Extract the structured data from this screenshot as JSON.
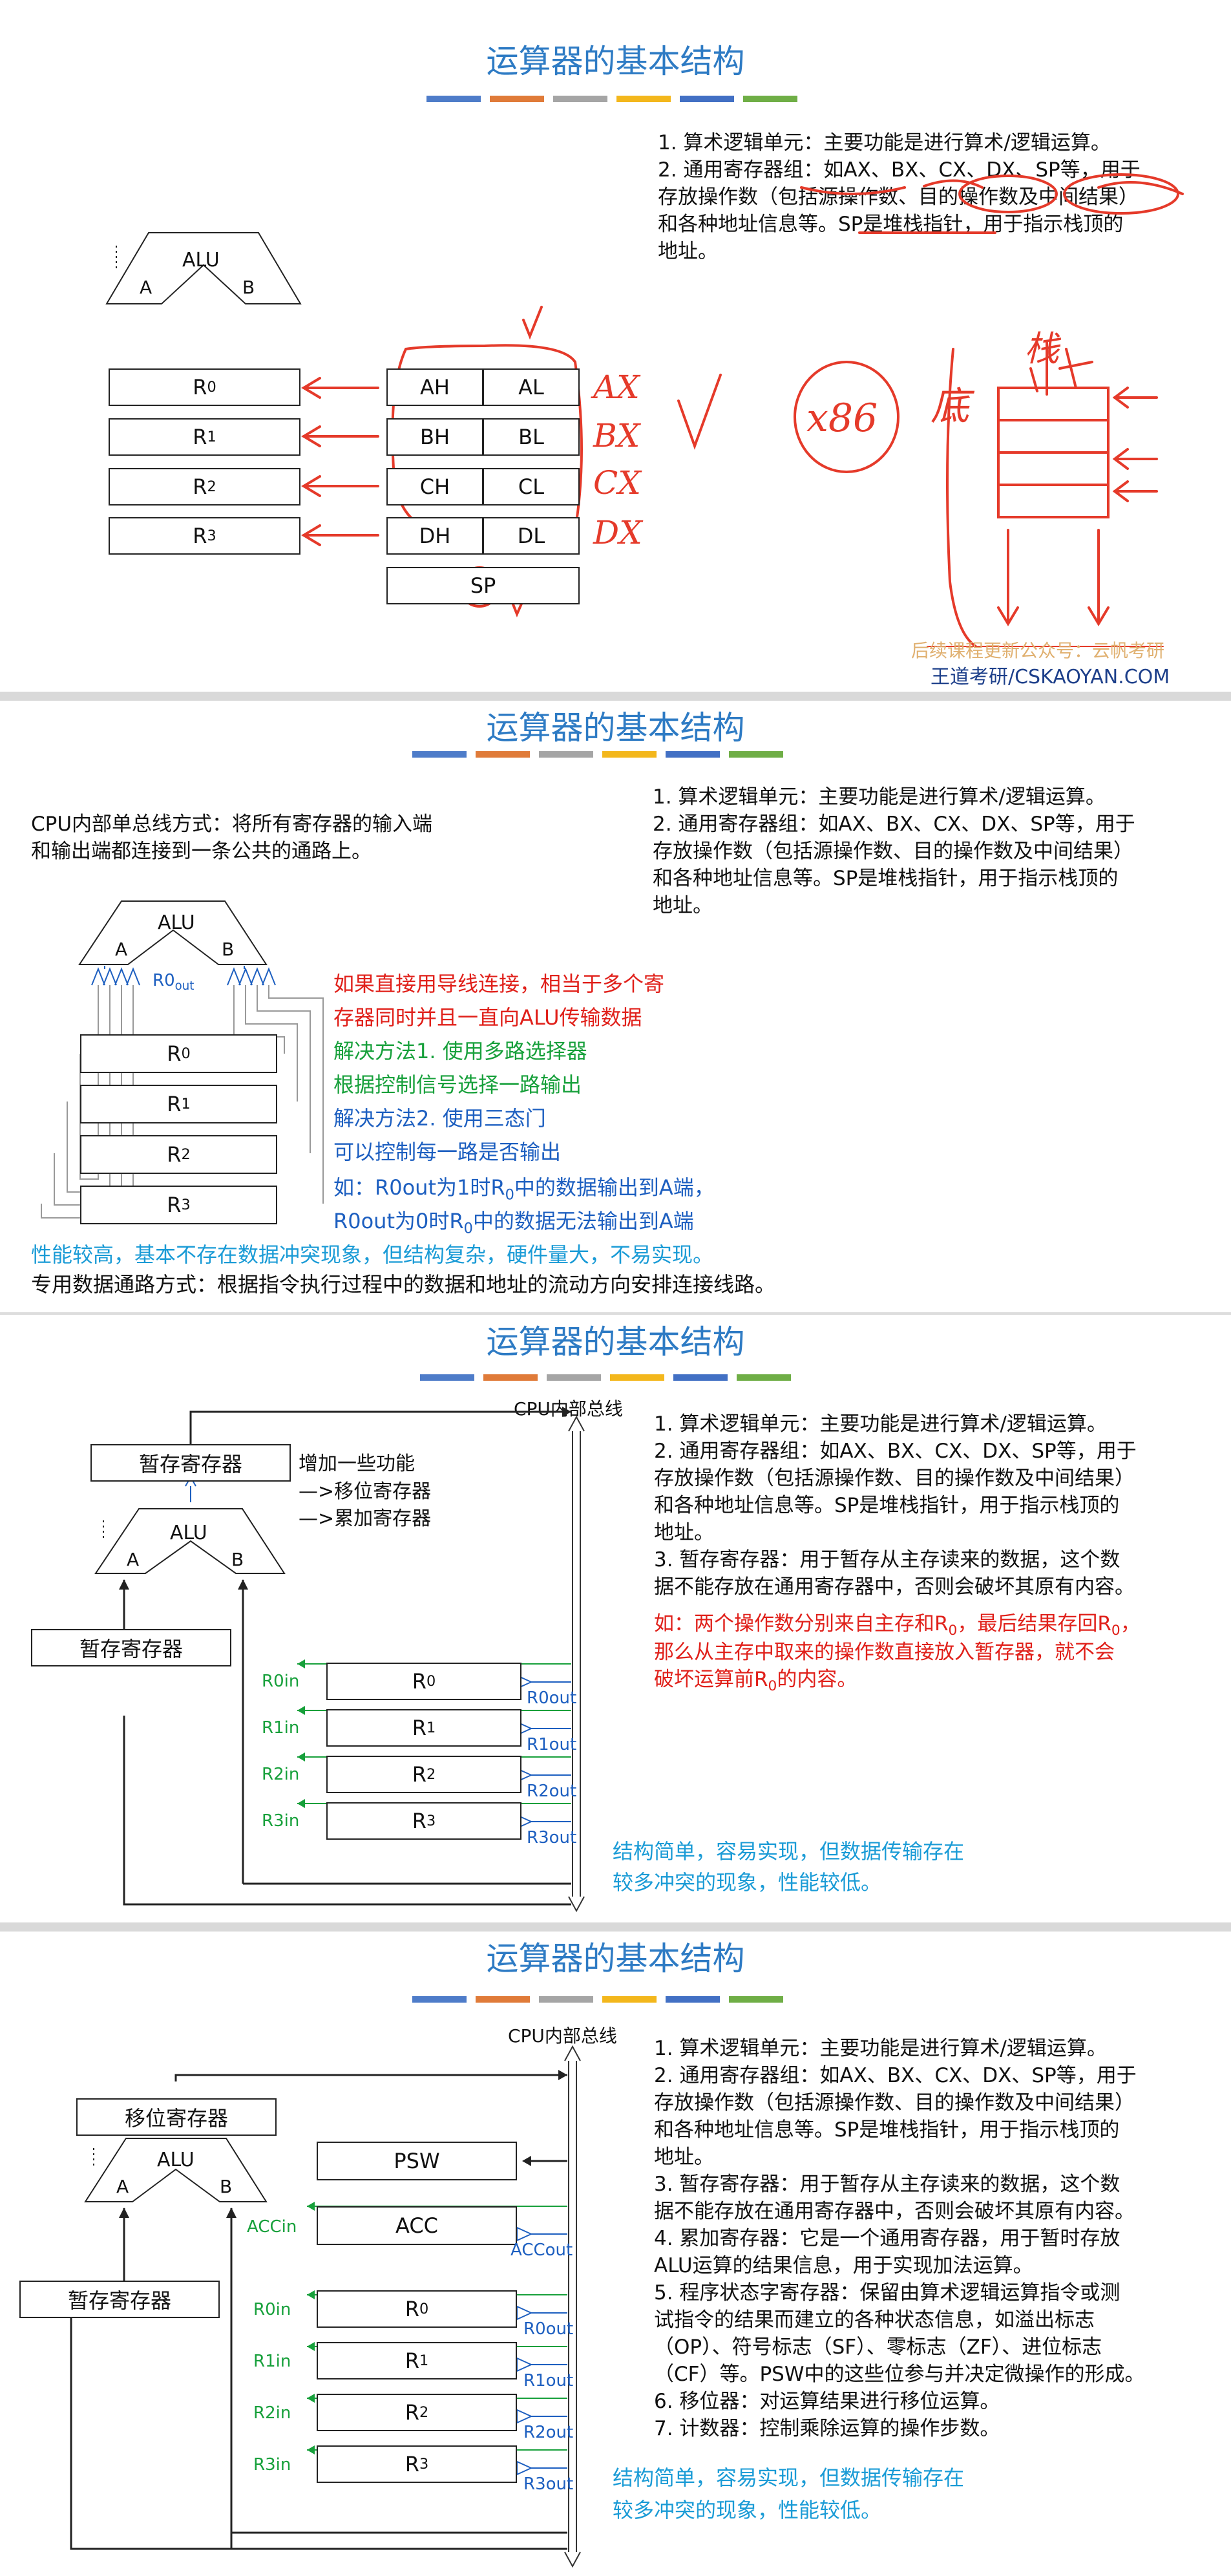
{
  "palette": [
    "#4e7cc9",
    "#e07b39",
    "#a5a5a5",
    "#f3b71c",
    "#4270c4",
    "#6fae46"
  ],
  "common": {
    "title": "运算器的基本结构",
    "alu": "ALU",
    "port_a": "A",
    "port_b": "B",
    "desc1": "1. 算术逻辑单元：主要功能是进行算术/逻辑运算。",
    "desc2": "2. 通用寄存器组：如AX、BX、CX、DX、SP等，用于\n存放操作数（包括源操作数、目的操作数及中间结果）\n和各种地址信息等。SP是堆栈指针，用于指示栈顶的\n地址。",
    "reg_r": "R",
    "sub0": "0",
    "sub1": "1",
    "sub2": "2",
    "sub3": "3",
    "bus_label": "CPU内部总线",
    "tmp_reg": "暂存寄存器"
  },
  "slide1": {
    "regs_h": [
      "AH",
      "BH",
      "CH",
      "DH"
    ],
    "regs_l": [
      "AL",
      "BL",
      "CL",
      "DL"
    ],
    "sp": "SP",
    "ann_ax": "AX",
    "ann_bx": "BX",
    "ann_cx": "CX",
    "ann_dx": "DX",
    "ann_x86": "x86",
    "ann_di": "底",
    "ann_ding": "栈",
    "watermark1": "后续课程更新公众号：云帆考研",
    "watermark2": "王道考研/CSKAOYAN.COM"
  },
  "slide2": {
    "intro": "CPU内部单总线方式：将所有寄存器的输入端\n和输出端都连接到一条公共的通路上。",
    "r0out": "R0",
    "r0out_sub": "out",
    "red_note": "如果直接用导线连接，相当于多个寄\n存器同时并且一直向ALU传输数据",
    "sol1": "解决方法1. 使用多路选择器\n根据控制信号选择一路输出",
    "sol2": "解决方法2. 使用三态门\n可以控制每一路是否输出",
    "eg1_a": "如：R0out为1时R",
    "eg1_b": "中的数据输出到A端，",
    "eg2_a": "R0out为0时R",
    "eg2_b": "中的数据无法输出到A端",
    "perf": "性能较高，基本不存在数据冲突现象，但结构复杂，硬件量大，不易实现。",
    "dedicated": "专用数据通路方式：根据指令执行过程中的数据和地址的流动方向安排连接线路。"
  },
  "slide3": {
    "extra_title": "增加一些功能",
    "extra1": "—>移位寄存器",
    "extra2": "—>累加寄存器",
    "in_labels": [
      "R0in",
      "R1in",
      "R2in",
      "R3in"
    ],
    "out_labels": [
      "R0out",
      "R1out",
      "R2out",
      "R3out"
    ],
    "desc3": "3. 暂存寄存器：用于暂存从主存读来的数据，这个数\n据不能存放在通用寄存器中，否则会破坏其原有内容。",
    "red_a": "如：两个操作数分别来自主存和R",
    "red_b": "，最后结果存回R",
    "red_c": "，",
    "red_line2": "那么从主存中取来的操作数直接放入暂存器，就不会",
    "red_line3_a": "破坏运算前R",
    "red_line3_b": "的内容。",
    "summary": "结构简单，容易实现，但数据传输存在\n较多冲突的现象，性能较低。"
  },
  "slide4": {
    "shift_reg": "移位寄存器",
    "psw": "PSW",
    "acc": "ACC",
    "acc_in": "ACCin",
    "acc_out": "ACCout",
    "in_labels": [
      "R0in",
      "R1in",
      "R2in",
      "R3in"
    ],
    "out_labels": [
      "R0out",
      "R1out",
      "R2out",
      "R3out"
    ],
    "desc3": "3. 暂存寄存器：用于暂存从主存读来的数据，这个数\n据不能存放在通用寄存器中，否则会破坏其原有内容。",
    "desc4": "4. 累加寄存器：它是一个通用寄存器，用于暂时存放\nALU运算的结果信息，用于实现加法运算。",
    "desc5": "5. 程序状态字寄存器：保留由算术逻辑运算指令或测\n试指令的结果而建立的各种状态信息，如溢出标志\n（OP）、符号标志（SF）、零标志（ZF）、进位标志\n（CF）等。PSW中的这些位参与并决定微操作的形成。",
    "desc6": "6. 移位器：对运算结果进行移位运算。",
    "desc7": "7. 计数器：控制乘除运算的操作步数。",
    "summary": "结构简单，容易实现，但数据传输存在\n较多冲突的现象，性能较低。"
  }
}
